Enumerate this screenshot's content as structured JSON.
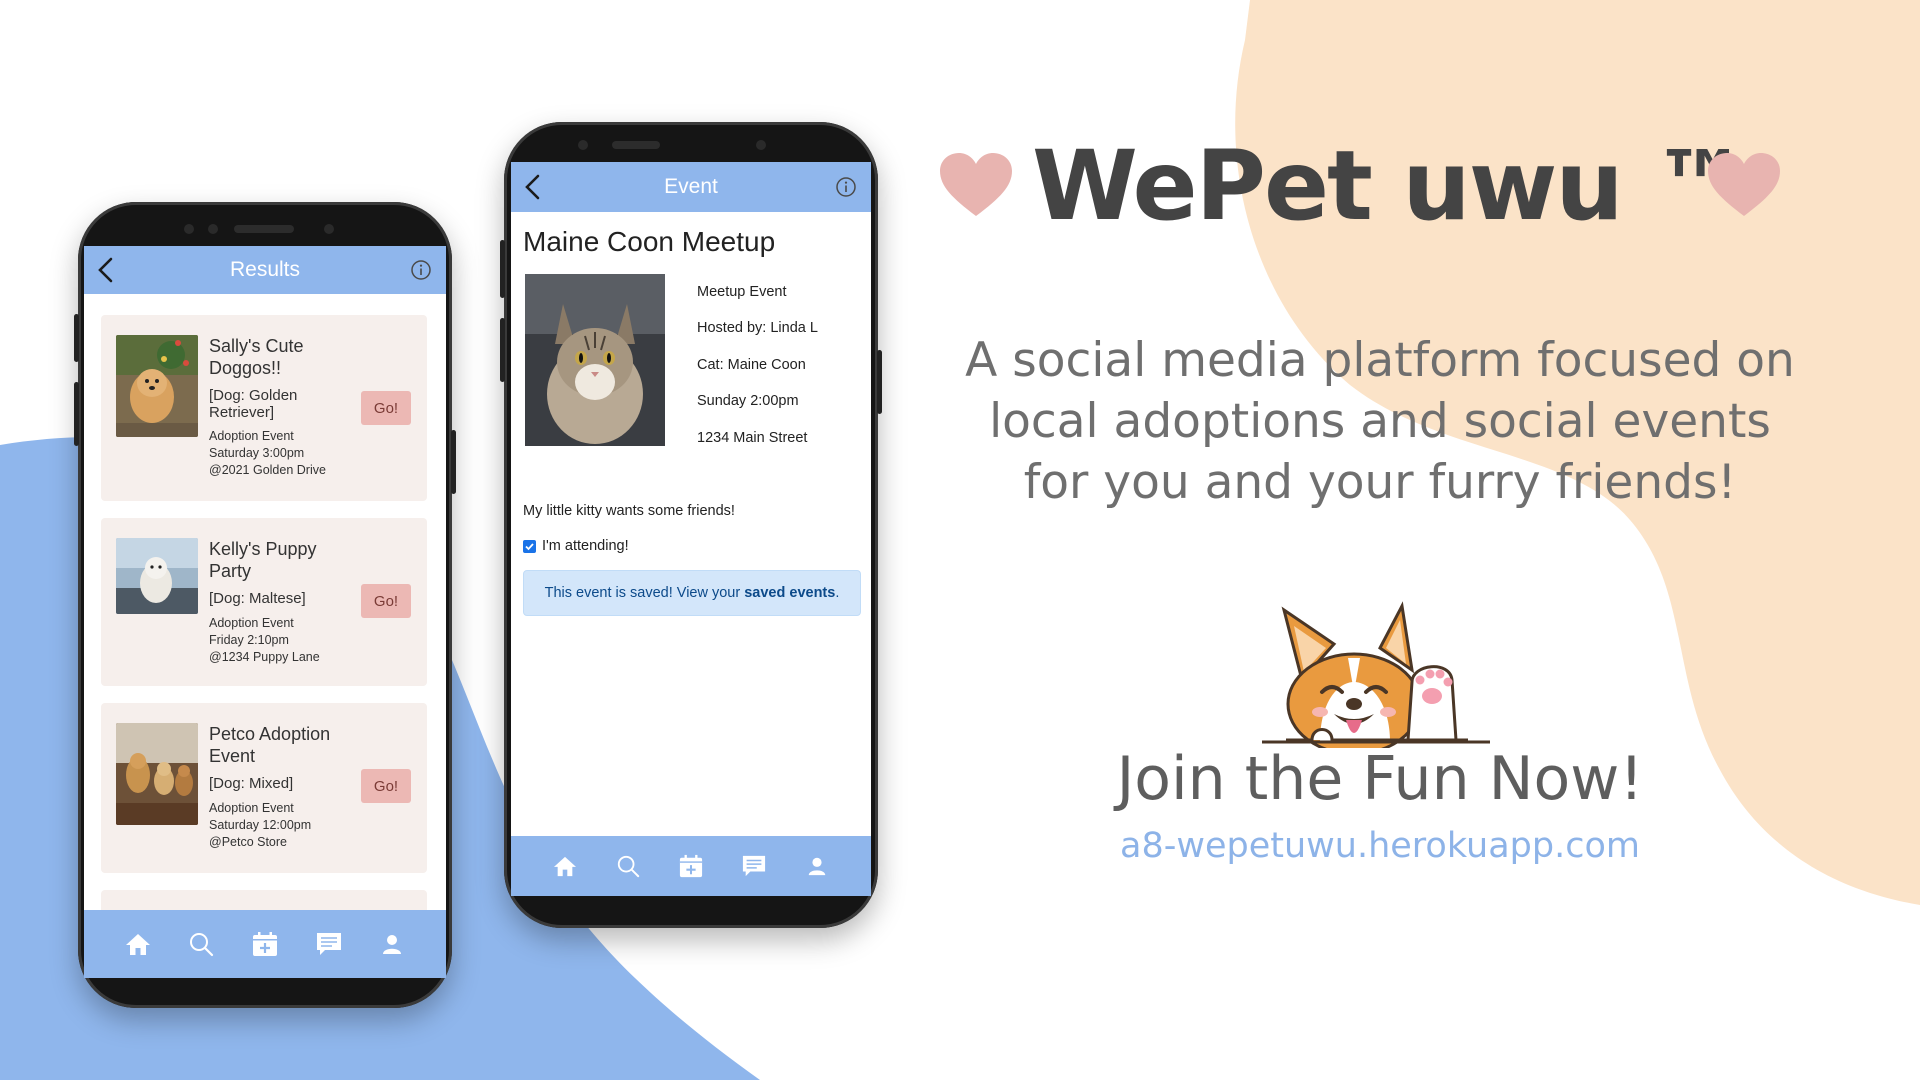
{
  "colors": {
    "accent_blue": "#8fb6ec",
    "peach": "#fbe3c8",
    "card_bg": "#f6efec",
    "go_button": "#ecb8b4",
    "heart": "#e8b4b0",
    "url": "#8db3e8"
  },
  "results_phone": {
    "header_title": "Results",
    "cards": [
      {
        "title": "Sally's Cute Doggos!!",
        "tag": "[Dog: Golden Retriever]",
        "type": "Adoption Event",
        "time": "Saturday 3:00pm",
        "location": "@2021 Golden Drive",
        "button": "Go!"
      },
      {
        "title": "Kelly's Puppy Party",
        "tag": "[Dog: Maltese]",
        "type": "Adoption Event",
        "time": "Friday 2:10pm",
        "location": "@1234 Puppy Lane",
        "button": "Go!"
      },
      {
        "title": "Petco Adoption Event",
        "tag": "[Dog: Mixed]",
        "type": "Adoption Event",
        "time": "Saturday 12:00pm",
        "location": "@Petco Store",
        "button": "Go!"
      }
    ],
    "nav_icons": [
      "home-icon",
      "search-icon",
      "calendar-add-icon",
      "chat-icon",
      "profile-icon"
    ]
  },
  "event_phone": {
    "header_title": "Event",
    "event_title": "Maine Coon Meetup",
    "details": {
      "type": "Meetup Event",
      "host": "Hosted by: Linda L",
      "pet": "Cat: Maine Coon",
      "time": "Sunday 2:00pm",
      "address": "1234 Main Street"
    },
    "description": "My little kitty wants some friends!",
    "attending_label": "I'm attending!",
    "attending_checked": true,
    "saved_text": "This event is saved! View your",
    "saved_link": "saved events",
    "saved_period": "."
  },
  "promo": {
    "brand": "WePet uwu ™",
    "tagline_lines": [
      "A social media platform focused on",
      "local adoptions and social events",
      "for you and your furry friends!"
    ],
    "cta": "Join the Fun Now!",
    "url": "a8-wepetuwu.herokuapp.com"
  }
}
